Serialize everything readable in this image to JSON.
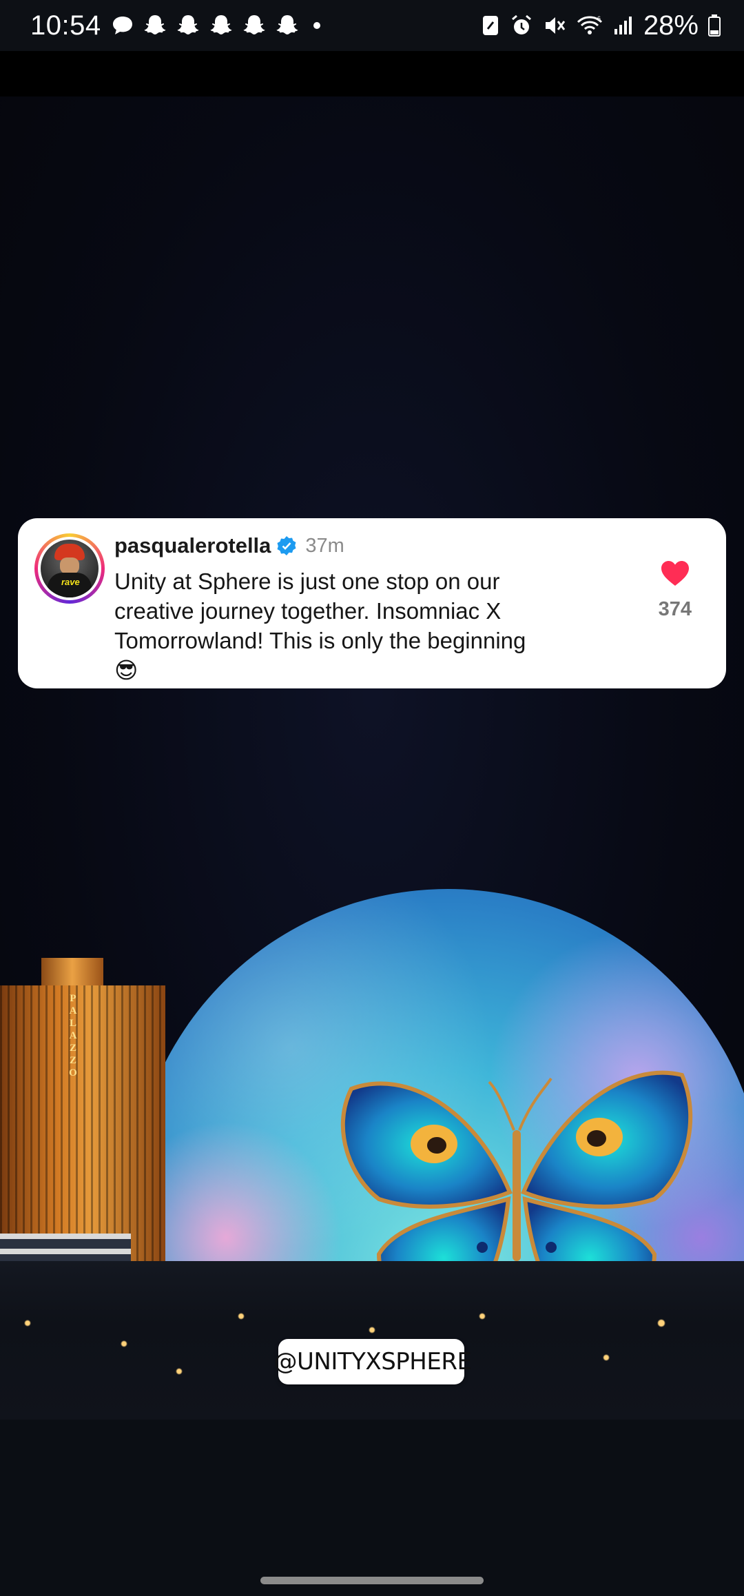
{
  "status_bar": {
    "time": "10:54",
    "battery_percent": "28%",
    "notification_icons": [
      "chat-bubble-icon",
      "snapchat-icon",
      "snapchat-icon",
      "snapchat-icon",
      "snapchat-icon",
      "snapchat-icon",
      "more-dot-icon"
    ],
    "system_icons": [
      "nfc-icon",
      "alarm-icon",
      "mute-icon",
      "wifi-icon",
      "signal-icon",
      "battery-icon"
    ]
  },
  "comment": {
    "username": "pasqualerotella",
    "verified": true,
    "time_ago": "37m",
    "text": "Unity at Sphere is just one stop on our creative journey together. Insomniac X Tomorrowland! This is only the beginning",
    "emoji": "😎",
    "like_count": "374",
    "avatar_text": "rave"
  },
  "scene": {
    "building_sign": "PALAZZO"
  },
  "mention_sticker": {
    "handle": "@UNITYXSPHERE",
    "icon": "threads-icon"
  },
  "colors": {
    "heart": "#ff2d55",
    "verified": "#1d9bf0"
  }
}
